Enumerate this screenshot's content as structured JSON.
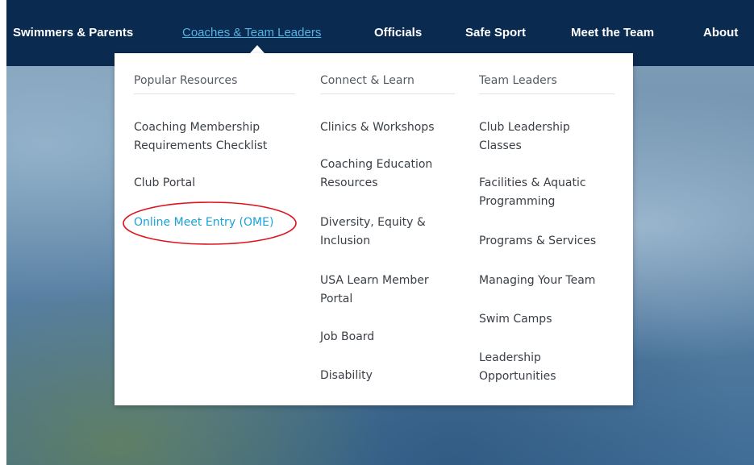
{
  "nav": {
    "items": [
      {
        "label": "Swimmers & Parents"
      },
      {
        "label": "Coaches & Team Leaders"
      },
      {
        "label": "Officials"
      },
      {
        "label": "Safe Sport"
      },
      {
        "label": "Meet the Team"
      },
      {
        "label": "About"
      }
    ]
  },
  "dropdown": {
    "popular": {
      "heading": "Popular Resources",
      "links": [
        {
          "label": "Coaching Membership Requirements Checklist"
        },
        {
          "label": "Club Portal"
        },
        {
          "label": "Online Meet Entry (OME)"
        }
      ]
    },
    "connect": {
      "heading": "Connect & Learn",
      "links": [
        {
          "label": "Clinics & Workshops"
        },
        {
          "label": "Coaching Education Resources"
        },
        {
          "label": "Diversity, Equity & Inclusion"
        },
        {
          "label": "USA Learn Member Portal"
        },
        {
          "label": "Job Board"
        },
        {
          "label": "Disability"
        }
      ]
    },
    "leaders": {
      "heading": "Team Leaders",
      "links": [
        {
          "label": "Club Leadership Classes"
        },
        {
          "label": "Facilities & Aquatic Programming"
        },
        {
          "label": "Programs & Services"
        },
        {
          "label": "Managing Your Team"
        },
        {
          "label": "Swim Camps"
        },
        {
          "label": "Leadership Opportunities"
        }
      ]
    }
  },
  "colors": {
    "navbar": "#0b2a4f",
    "active_link": "#53b4e6",
    "highlight_link": "#1aa3d9",
    "annotation": "#e0141e"
  }
}
